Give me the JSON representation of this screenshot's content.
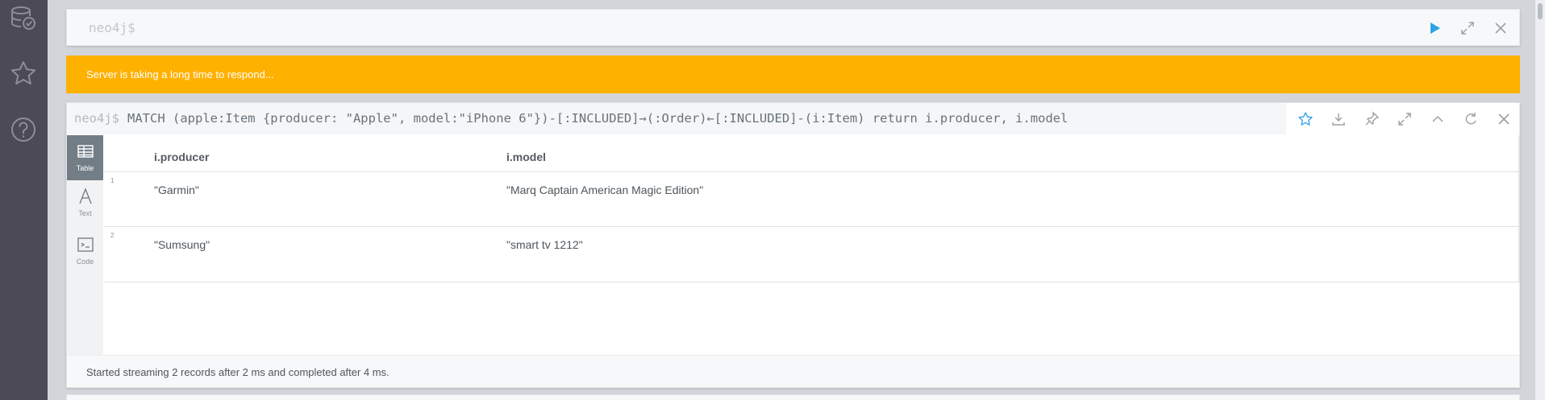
{
  "sidebar": {
    "icons": [
      "database-icon",
      "star-icon",
      "help-icon"
    ]
  },
  "editor": {
    "prompt": "neo4j$",
    "buttons": [
      "play-icon",
      "expand-icon",
      "close-icon"
    ]
  },
  "banner": {
    "text": "Server is taking a long time to respond...",
    "color": "#ffb100"
  },
  "frame": {
    "prompt": "neo4j$",
    "query": "MATCH (apple:Item {producer: \"Apple\", model:\"iPhone 6\"})-[:INCLUDED]→(:Order)←[:INCLUDED]-(i:Item) return i.producer, i.model",
    "header_buttons": [
      "star-icon",
      "download-icon",
      "pin-icon",
      "fullscreen-icon",
      "collapse-icon",
      "rerun-icon",
      "close-icon"
    ],
    "view_tabs": [
      {
        "label": "Table",
        "icon": "table-icon",
        "active": true
      },
      {
        "label": "Text",
        "icon": "text-icon",
        "active": false
      },
      {
        "label": "Code",
        "icon": "code-icon",
        "active": false
      }
    ],
    "table": {
      "columns": [
        "i.producer",
        "i.model"
      ],
      "rows": [
        {
          "num": "1",
          "cells": [
            "\"Garmin\"",
            "\"Marq Captain American Magic Edition\""
          ]
        },
        {
          "num": "2",
          "cells": [
            "\"Sumsung\"",
            "\"smart tv 1212\""
          ]
        }
      ]
    },
    "status": "Started streaming 2 records after 2 ms and completed after 4 ms."
  }
}
